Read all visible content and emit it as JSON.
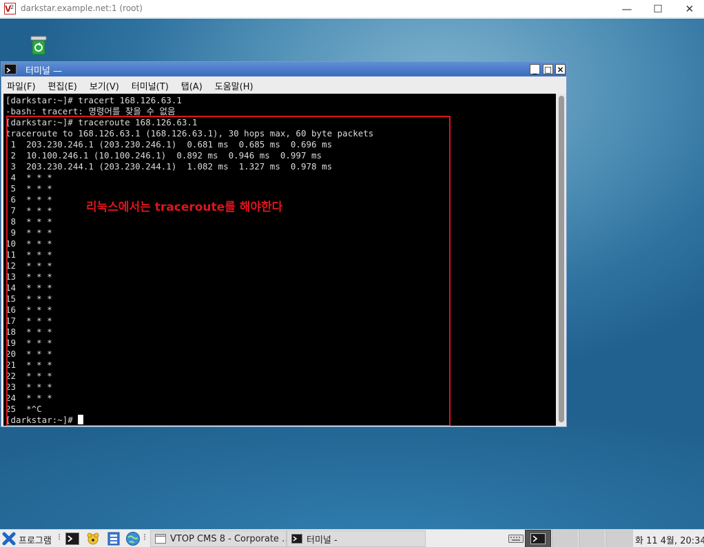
{
  "vnc_window": {
    "title": "darkstar.example.net:1 (root)",
    "minimize_glyph": "—",
    "maximize_glyph": "☐",
    "close_glyph": "✕"
  },
  "desktop": {
    "trash_icon": "trash-icon"
  },
  "terminal": {
    "title": "터미널 —",
    "menu": [
      "파일(F)",
      "편집(E)",
      "보기(V)",
      "터미널(T)",
      "탭(A)",
      "도움말(H)"
    ],
    "lines": [
      "[darkstar:~]# tracert 168.126.63.1",
      "-bash: tracert: 명령어를 찾을 수 없음",
      "[darkstar:~]# traceroute 168.126.63.1",
      "traceroute to 168.126.63.1 (168.126.63.1), 30 hops max, 60 byte packets",
      " 1  203.230.246.1 (203.230.246.1)  0.681 ms  0.685 ms  0.696 ms",
      " 2  10.100.246.1 (10.100.246.1)  0.892 ms  0.946 ms  0.997 ms",
      " 3  203.230.244.1 (203.230.244.1)  1.082 ms  1.327 ms  0.978 ms",
      " 4  * * *",
      " 5  * * *",
      " 6  * * *",
      " 7  * * *",
      " 8  * * *",
      " 9  * * *",
      "10  * * *",
      "11  * * *",
      "12  * * *",
      "13  * * *",
      "14  * * *",
      "15  * * *",
      "16  * * *",
      "17  * * *",
      "18  * * *",
      "19  * * *",
      "20  * * *",
      "21  * * *",
      "22  * * *",
      "23  * * *",
      "24  * * *",
      "25  *^C"
    ],
    "prompt": "[darkstar:~]# ",
    "annotation": "리눅스에서는 traceroute를 해야한다",
    "annotation_color": "#e0141c"
  },
  "taskbar": {
    "start_label": "프로그램",
    "tasks": [
      {
        "label": "VTOP CMS 8 - Corporate …",
        "icon": "browser-window-icon"
      },
      {
        "label": "터미널 -",
        "icon": "terminal-icon"
      }
    ],
    "clock": "화 11  4월, 20:34"
  }
}
